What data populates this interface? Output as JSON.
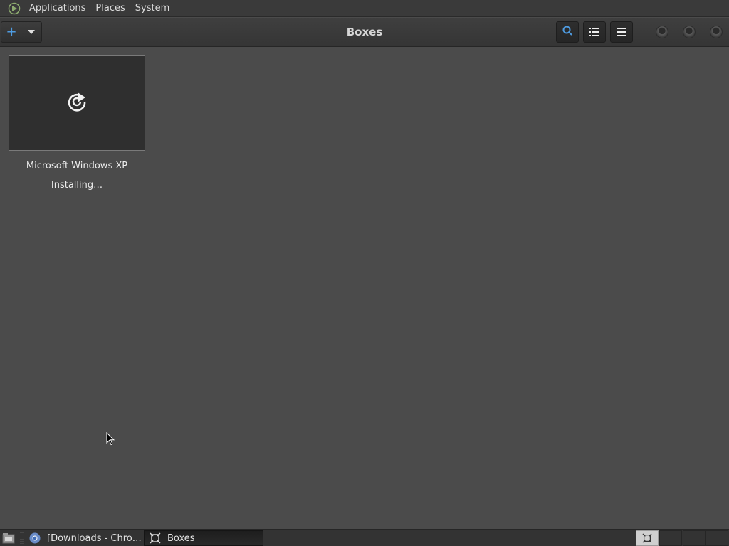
{
  "top_panel": {
    "menus": [
      "Applications",
      "Places",
      "System"
    ]
  },
  "header": {
    "title": "Boxes",
    "new_icon": "plus-icon",
    "dropdown_icon": "caret-down-icon",
    "search_icon": "search-icon",
    "list_view_icon": "list-view-icon",
    "menu_icon": "hamburger-menu-icon"
  },
  "boxes": [
    {
      "name": "Microsoft Windows XP",
      "status": "Installing…",
      "icon": "installing-spinner-icon"
    }
  ],
  "taskbar": {
    "tasks": [
      {
        "label": "[Downloads - Chro…",
        "icon": "chrome-icon",
        "active": false
      },
      {
        "label": "Boxes",
        "icon": "boxes-icon",
        "active": true
      }
    ]
  },
  "colors": {
    "accent": "#4e9be0",
    "background": "#4b4b4b"
  }
}
